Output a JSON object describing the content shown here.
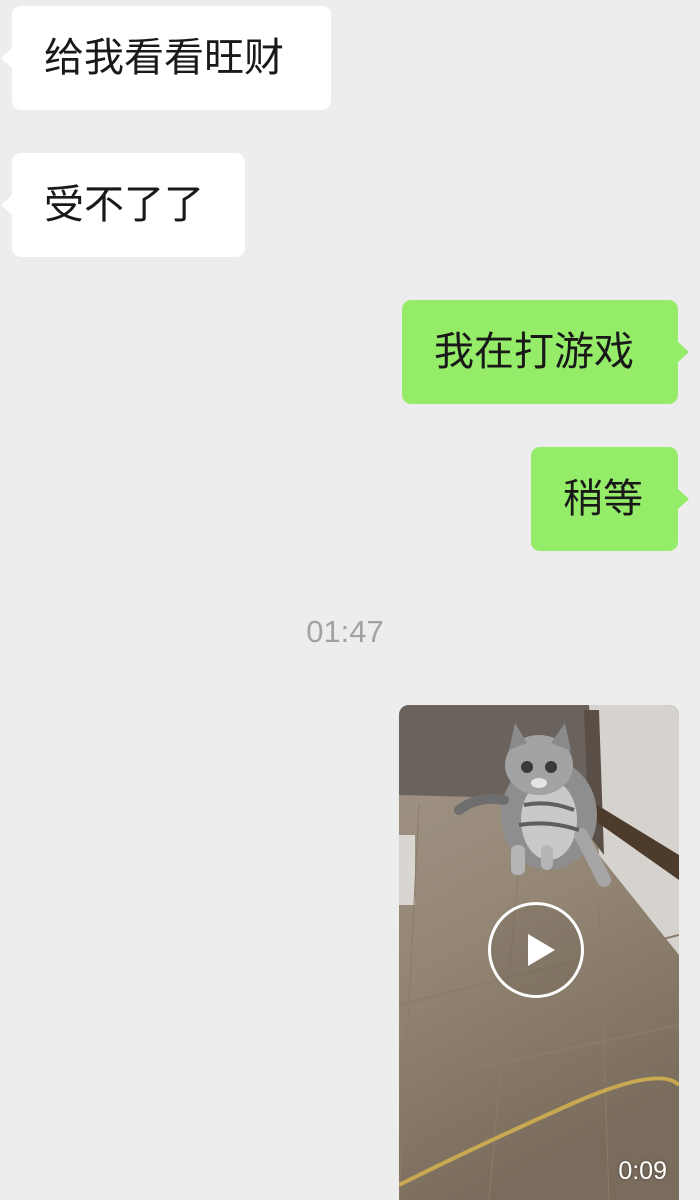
{
  "messages": [
    {
      "direction": "in",
      "text": "给我看看旺财"
    },
    {
      "direction": "in",
      "text": "受不了了"
    },
    {
      "direction": "out",
      "text": "我在打游戏"
    },
    {
      "direction": "out",
      "text": "稍等"
    }
  ],
  "timestamp": "01:47",
  "video": {
    "duration": "0:09",
    "play_icon": "play-icon"
  },
  "colors": {
    "background": "#ededed",
    "incoming_bubble": "#ffffff",
    "outgoing_bubble": "#95ec69",
    "timestamp_text": "#a2a2a2"
  }
}
